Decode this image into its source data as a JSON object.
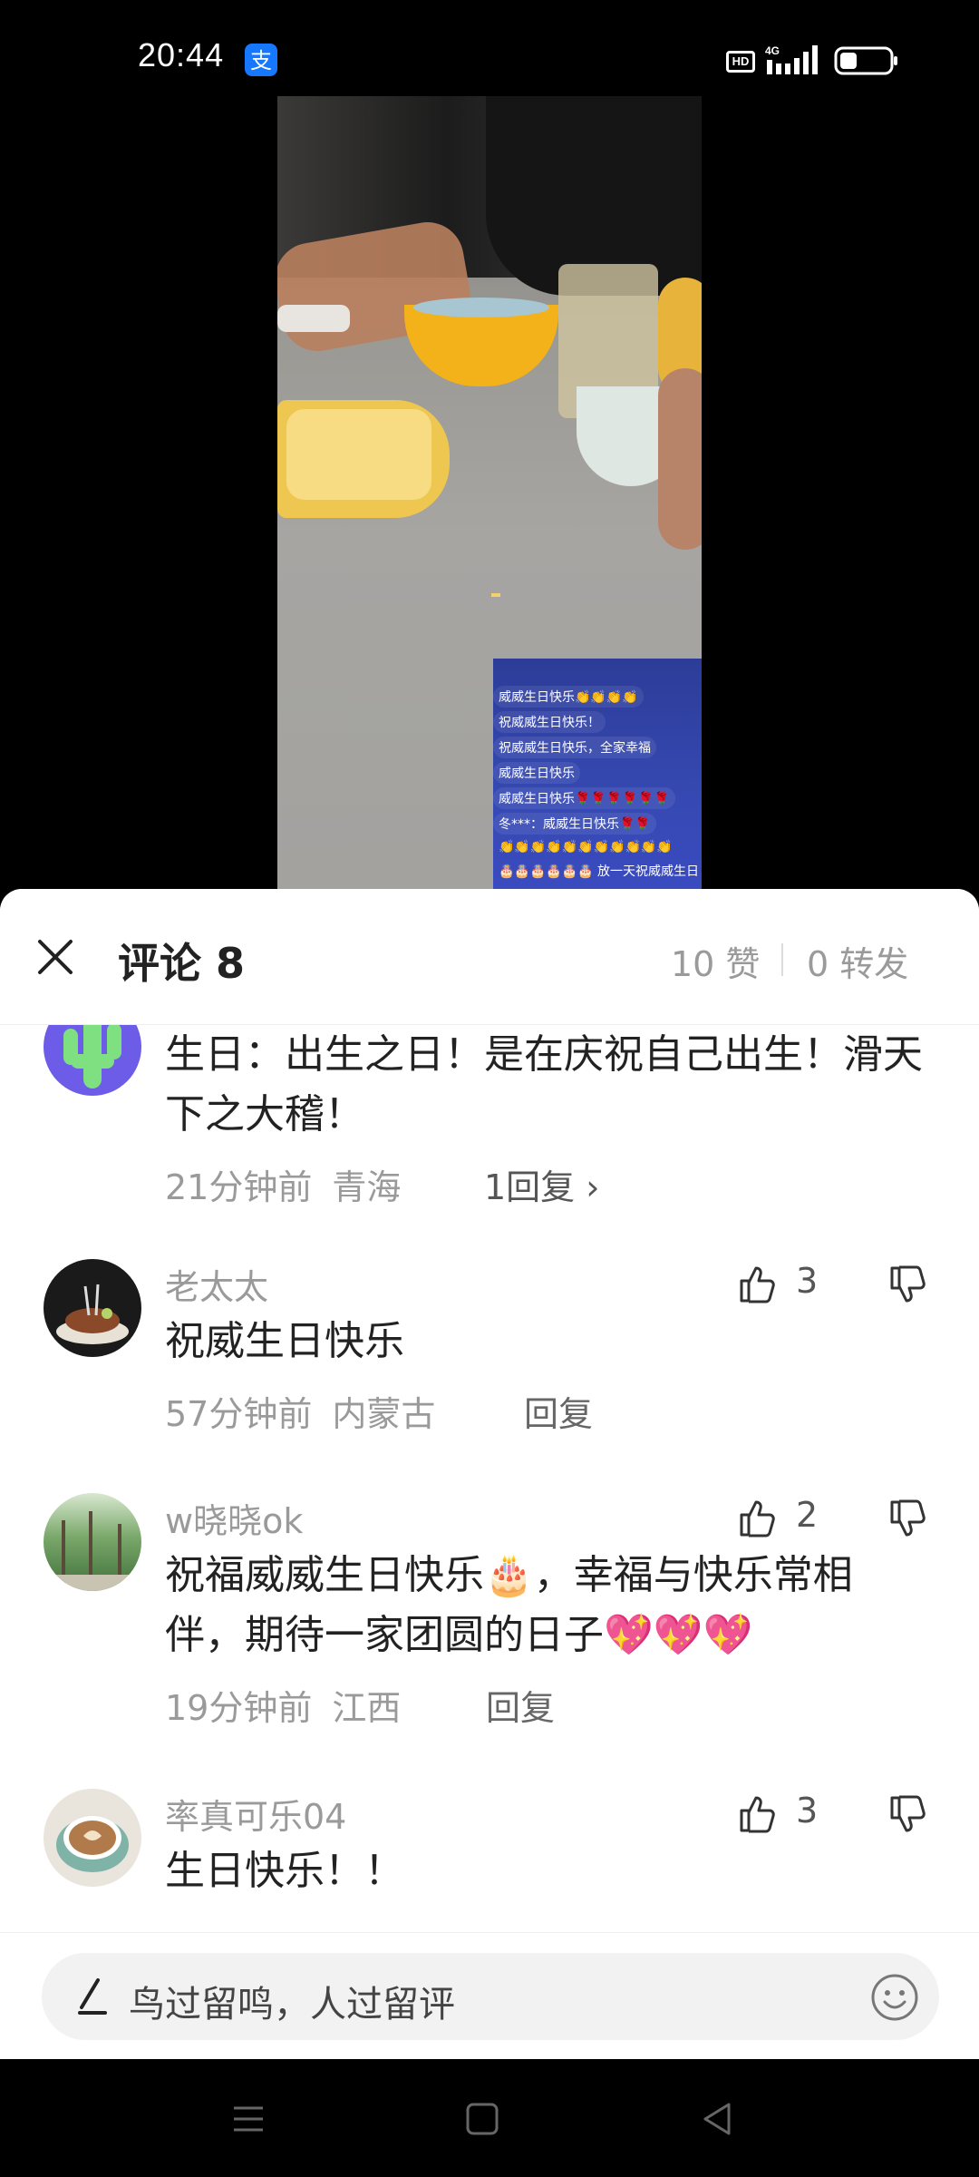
{
  "status_bar": {
    "time": "20:44",
    "icons": [
      "alipay-icon",
      "hd-icon",
      "signal-4g-icon",
      "battery-icon"
    ],
    "hd_label": "HD",
    "network_label": "4G"
  },
  "video": {
    "danmaku": [
      "威威生日快乐👏👏👏👏",
      "祝威威生日快乐！",
      "祝威威生日快乐，全家幸福",
      "威威生日快乐",
      "威威生日快乐🌹🌹🌹🌹🌹🌹",
      "冬***：威威生日快乐🌹🌹",
      "👏👏👏👏👏👏👏👏👏👏👏",
      "🎂🎂🎂🎂🎂🎂 放一天祝威威生日"
    ]
  },
  "sheet": {
    "title": "评论 8",
    "likes": "10 赞",
    "shares": "0 转发"
  },
  "comments": [
    {
      "username": "",
      "text": "生日：出生之日！是在庆祝自己出生！滑天下之大稽！",
      "time": "21分钟前",
      "region": "青海",
      "reply": "1回复 ›",
      "likes": ""
    },
    {
      "username": "老太太",
      "text": "祝威生日快乐",
      "time": "57分钟前",
      "region": "内蒙古",
      "reply": "回复",
      "likes": "3"
    },
    {
      "username": "w晓晓ok",
      "text": "祝福威威生日快乐🎂，幸福与快乐常相伴，期待一家团圆的日子💖💖💖",
      "time": "19分钟前",
      "region": "江西",
      "reply": "回复",
      "likes": "2"
    },
    {
      "username": "率真可乐04",
      "text": "生日快乐！！",
      "time": "",
      "region": "",
      "reply": "",
      "likes": "3"
    }
  ],
  "input": {
    "placeholder": "鸟过留鸣，人过留评"
  },
  "colors": {
    "accent_blue": "#1677ff",
    "text_primary": "#222222",
    "text_secondary": "#9a9a9a"
  }
}
